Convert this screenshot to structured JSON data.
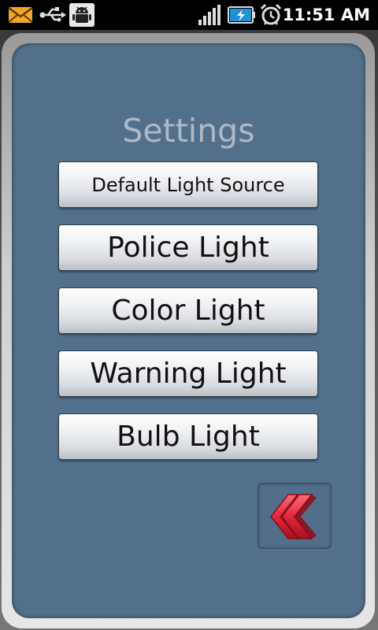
{
  "status_bar": {
    "time": "11:51 AM",
    "icons": [
      "mail-icon",
      "usb-icon",
      "android-debug-icon",
      "signal-icon",
      "battery-charging-icon",
      "alarm-icon"
    ]
  },
  "settings": {
    "title": "Settings",
    "buttons": [
      {
        "label": "Default Light Source"
      },
      {
        "label": "Police Light"
      },
      {
        "label": "Color Light"
      },
      {
        "label": "Warning Light"
      },
      {
        "label": "Bulb Light"
      }
    ],
    "back_icon": "double-chevron-left-icon"
  },
  "colors": {
    "panel_background": "#52708c",
    "title_text": "#aeb9c6",
    "back_arrow": "#e0283a"
  }
}
